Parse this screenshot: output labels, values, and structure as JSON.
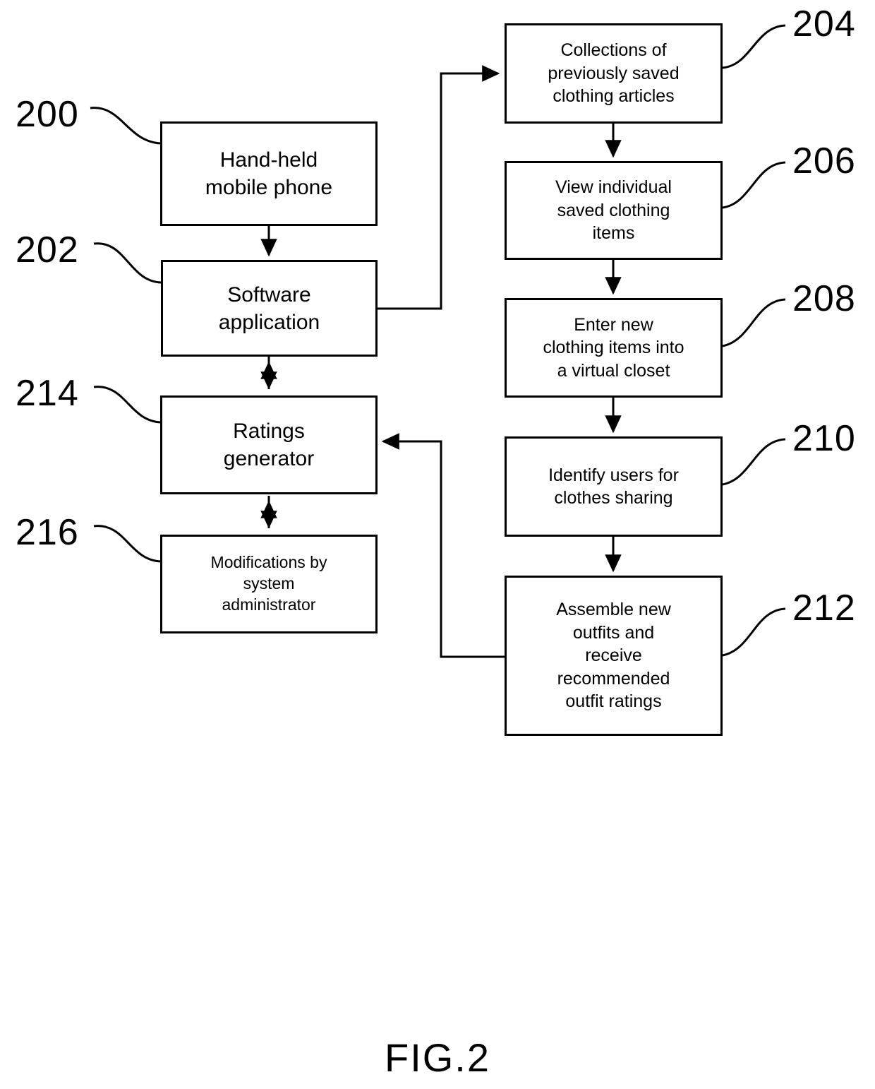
{
  "figure": {
    "caption": "FIG.2",
    "ink_color": "#000000",
    "background_color": "#ffffff"
  },
  "nodes": [
    {
      "id": "node-200",
      "ref": "200",
      "text": "Hand-held\nmobile phone",
      "name": "hand-held-mobile-phone-box"
    },
    {
      "id": "node-202",
      "ref": "202",
      "text": "Software\napplication",
      "name": "software-application-box"
    },
    {
      "id": "node-214",
      "ref": "214",
      "text": "Ratings\ngenerator",
      "name": "ratings-generator-box"
    },
    {
      "id": "node-216",
      "ref": "216",
      "text": "Modifications by\nsystem\nadministrator",
      "name": "modifications-by-system-administrator-box"
    },
    {
      "id": "node-204",
      "ref": "204",
      "text": "Collections of\npreviously saved\nclothing articles",
      "name": "collections-of-previously-saved-clothing-articles-box"
    },
    {
      "id": "node-206",
      "ref": "206",
      "text": "View individual\nsaved clothing\nitems",
      "name": "view-individual-saved-clothing-items-box"
    },
    {
      "id": "node-208",
      "ref": "208",
      "text": "Enter new\nclothing items into\na virtual closet",
      "name": "enter-new-clothing-items-into-a-virtual-closet-box"
    },
    {
      "id": "node-210",
      "ref": "210",
      "text": "Identify users for\nclothes sharing",
      "name": "identify-users-for-clothes-sharing-box"
    },
    {
      "id": "node-212",
      "ref": "212",
      "text": "Assemble new\noutfits and\nreceive\nrecommended\noutfit ratings",
      "name": "assemble-new-outfits-and-receive-recommended-outfit-ratings-box"
    }
  ],
  "reference_numerals": {
    "n200": "200",
    "n202": "202",
    "n204": "204",
    "n206": "206",
    "n208": "208",
    "n210": "210",
    "n212": "212",
    "n214": "214",
    "n216": "216"
  },
  "connectors": [
    {
      "name": "arrow-200-to-202",
      "from": "200",
      "to": "202",
      "style": "single-arrow-down"
    },
    {
      "name": "arrow-202-to-214",
      "from": "202",
      "to": "214",
      "style": "double-arrow-vertical"
    },
    {
      "name": "arrow-214-to-216",
      "from": "214",
      "to": "216",
      "style": "double-arrow-vertical"
    },
    {
      "name": "arrow-202-to-204",
      "from": "202",
      "to": "204",
      "style": "elbow-arrow-right"
    },
    {
      "name": "arrow-204-to-206",
      "from": "204",
      "to": "206",
      "style": "single-arrow-down"
    },
    {
      "name": "arrow-206-to-208",
      "from": "206",
      "to": "208",
      "style": "single-arrow-down"
    },
    {
      "name": "arrow-208-to-210",
      "from": "208",
      "to": "210",
      "style": "single-arrow-down"
    },
    {
      "name": "arrow-210-to-212",
      "from": "210",
      "to": "212",
      "style": "single-arrow-down"
    },
    {
      "name": "arrow-212-to-214",
      "from": "212",
      "to": "214",
      "style": "elbow-arrow-feedback"
    }
  ]
}
